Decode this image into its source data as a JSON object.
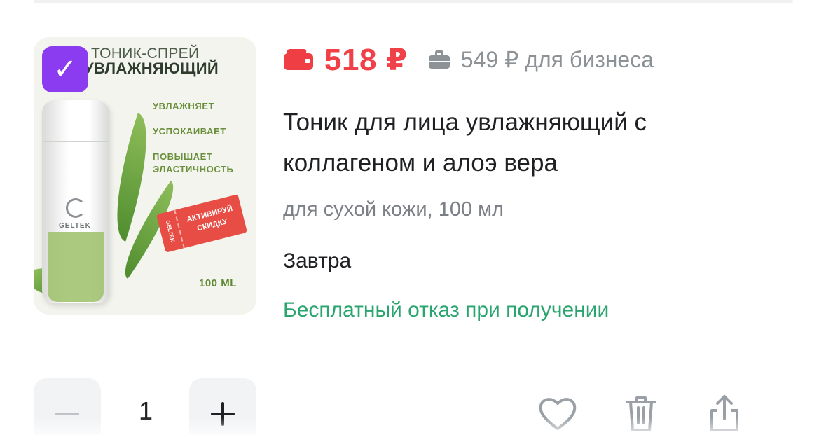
{
  "product": {
    "image": {
      "heading_line1": "ТОНИК-СПРЕЙ",
      "heading_line2": "УВЛАЖНЯЮЩИЙ",
      "features": [
        "УВЛАЖНЯЕТ",
        "УСПОКАИВАЕТ",
        "ПОВЫШАЕТ",
        "ЭЛАСТИЧНОСТЬ"
      ],
      "brand": "GELTEK",
      "ticket_stub": "GELTEK",
      "ticket_text": "АКТИВИРУЙ СКИДКУ",
      "volume": "100 ML",
      "selected": true
    },
    "price": "518 ₽",
    "business_price": "549 ₽ для бизнеса",
    "title": "Тоник для лица увлажняющий с коллагеном и алоэ вера",
    "variant": "для сухой кожи, 100 мл",
    "delivery": "Завтра",
    "refusal_note": "Бесплатный отказ при получении",
    "quantity": "1"
  },
  "colors": {
    "price": "#ef4147",
    "refusal": "#2aa56f",
    "badge": "#8b3bf0",
    "muted": "#8d9297"
  },
  "icons": {
    "price": "wallet-icon",
    "business": "briefcase-icon",
    "favorite": "heart-icon",
    "delete": "trash-icon",
    "share": "share-icon",
    "selected": "checkmark-icon"
  }
}
